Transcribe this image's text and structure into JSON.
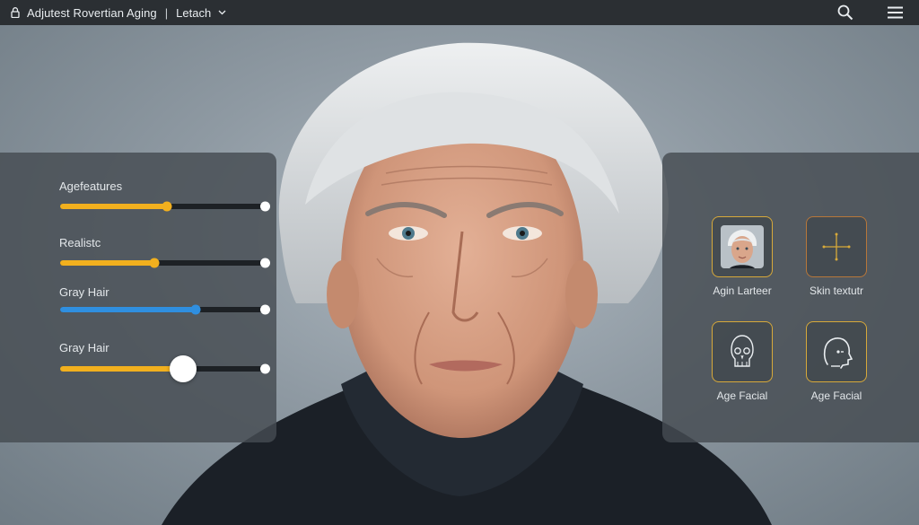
{
  "header": {
    "title": "Adjutest Rovertian Aging",
    "separator": "|",
    "mode": "Letach"
  },
  "icons": {
    "lock": "lock-icon",
    "chevron": "chevron-down-icon",
    "search": "search-icon",
    "menu": "hamburger-menu-icon"
  },
  "sliders": [
    {
      "label": "Agefeatures",
      "value": 0.52,
      "color": "#f2b01e"
    },
    {
      "label": "Realistc",
      "value": 0.46,
      "color": "#f2b01e"
    },
    {
      "label": "Gray Hair",
      "value": 0.66,
      "color": "#2f8fe0"
    },
    {
      "label": "Gray Hair",
      "value": 0.6,
      "color": "#f2b01e"
    }
  ],
  "tiles": [
    {
      "label": "Agin Larteer",
      "icon": "face-thumbnail-icon"
    },
    {
      "label": "Skin textutr",
      "icon": "crosshair-icon"
    },
    {
      "label": "Age Facial",
      "icon": "skull-icon"
    },
    {
      "label": "Age Facial",
      "icon": "head-profile-icon"
    }
  ],
  "colors": {
    "accent": "#f2b01e",
    "accent_blue": "#2f8fe0",
    "tile_border": "#d7a93a",
    "topbar": "#2b2f33"
  }
}
